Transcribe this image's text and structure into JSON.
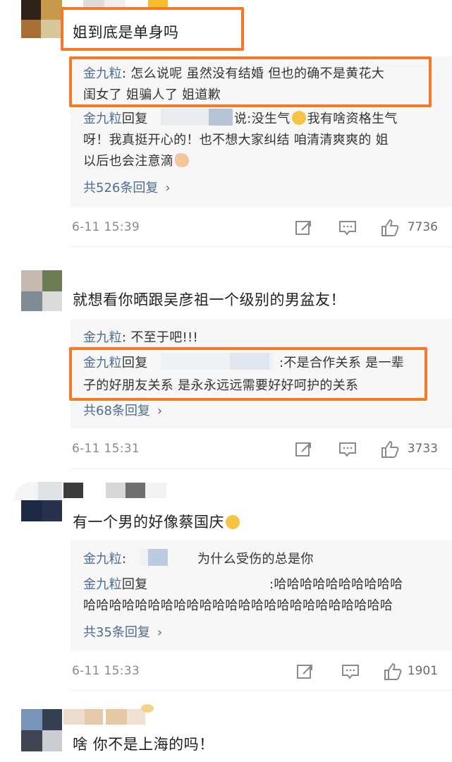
{
  "comments": [
    {
      "text": "姐到底是单身吗",
      "replies": [
        {
          "author": "金九粒",
          "sep": ":",
          "lines": [
            "怎么说呢 虽然没有结婚 但也的确不是黄花大",
            "闺女了 姐骗人了 姐道歉"
          ]
        },
        {
          "author": "金九粒",
          "verb": "回复",
          "tail": "说:没生气",
          "lines": [
            "我有啥资格生气",
            "呀！我真挺开心的！也不想大家纠结 咱清清爽爽的 姐",
            "以后也会注意滴"
          ]
        }
      ],
      "more": "共526条回复",
      "time": "6-11 15:39",
      "likes": "7736"
    },
    {
      "text": "就想看你晒跟吴彦祖一个级别的男盆友！",
      "replies": [
        {
          "author": "金九粒",
          "sep": ":",
          "lines": [
            "不至于吧!!!"
          ]
        },
        {
          "author": "金九粒",
          "verb": "回复",
          "tail": ":不是合作关系 是一辈",
          "lines": [
            "子的好朋友关系 是永永远远需要好好呵护的关系"
          ]
        }
      ],
      "more": "共68条回复",
      "time": "6-11 15:31",
      "likes": "3733"
    },
    {
      "text": "有一个男的好像蔡国庆",
      "replies": [
        {
          "author": "金九粒",
          "sep": ":",
          "tail": "为什么受伤的总是你"
        },
        {
          "author": "金九粒",
          "verb": "回复",
          "tail": ":哈哈哈哈哈哈哈哈哈哈",
          "lines": [
            "哈哈哈哈哈哈哈哈哈哈哈哈哈哈哈哈哈哈哈哈哈哈哈哈"
          ]
        }
      ],
      "more": "共35条回复",
      "time": "6-11 15:33",
      "likes": "1901"
    },
    {
      "text": "啥 你不是上海的吗！"
    }
  ],
  "icons": {
    "more_chevron": "›",
    "repost": "repost-icon",
    "comment": "comment-icon",
    "like": "thumbs-up-icon"
  },
  "colors": {
    "highlight": "#f47a27",
    "author": "#4f6b8f",
    "reply_bg": "#f7f7f7"
  }
}
